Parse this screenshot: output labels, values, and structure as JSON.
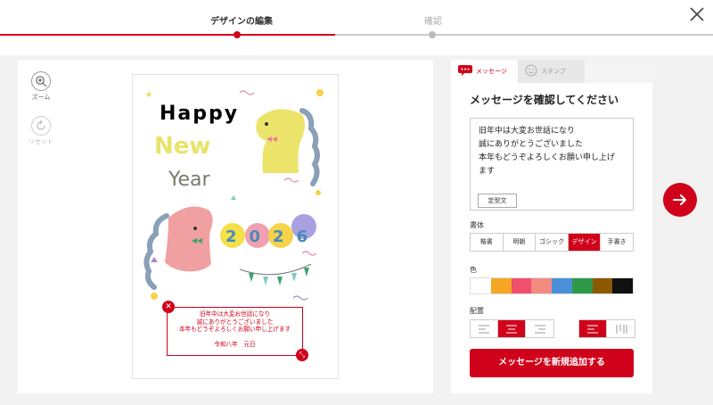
{
  "steps": [
    {
      "label": "デザインの編集"
    },
    {
      "label": "確認"
    }
  ],
  "tools": {
    "zoom_label": "ズーム",
    "reset_label": "リセット"
  },
  "card": {
    "message_lines": [
      "旧年中は大変お世話になり",
      "誠にありがとうございました",
      "本年もどうぞよろしくお願い申し上げます"
    ],
    "signature": "令和八年　元日",
    "art_year": "2026",
    "art_word1": "Happy",
    "art_word2": "New",
    "art_word3": "Year"
  },
  "tabs": {
    "message": "メッセージ",
    "stamp": "スタンプ"
  },
  "panel": {
    "title": "メッセージを確認してください",
    "text_lines": [
      "旧年中は大変お世話になり",
      "誠にありがとうございました",
      "本年もどうぞよろしくお願い申し上げ",
      "ます"
    ],
    "template_button": "定型文",
    "font_label": "書体",
    "fonts": [
      "楷書",
      "明朝",
      "ゴシック",
      "デザイン",
      "手書き"
    ],
    "font_selected": "デザイン",
    "color_label": "色",
    "colors": [
      "#ffffff",
      "#f5a623",
      "#f0506e",
      "#f28b82",
      "#4a90d9",
      "#2e9a49",
      "#8b5a00",
      "#111111"
    ],
    "align_label": "配置",
    "add_button": "メッセージを新規追加する"
  },
  "accent_color": "#d0021b"
}
